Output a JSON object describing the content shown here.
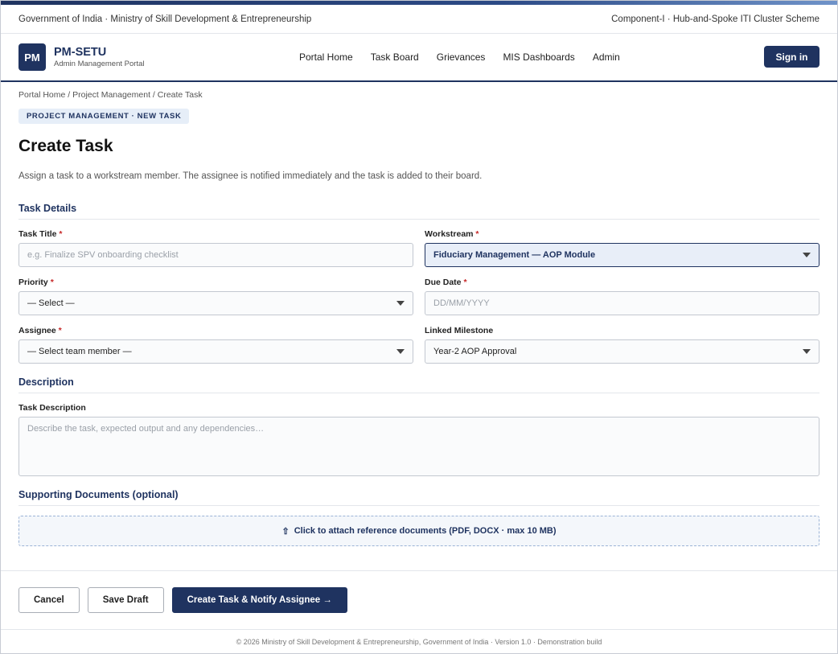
{
  "gov_bar": {
    "left": "Government of India · Ministry of Skill Development & Entrepreneurship",
    "right": "Component-I · Hub-and-Spoke ITI Cluster Scheme"
  },
  "header": {
    "logo": "PM",
    "title": "PM-SETU",
    "subtitle": "Admin Management Portal",
    "nav": [
      "Portal Home",
      "Task Board",
      "Grievances",
      "MIS Dashboards",
      "Admin"
    ],
    "signin_label": "Sign in"
  },
  "breadcrumb": "Portal Home / Project Management / Create Task",
  "tag": "PROJECT MANAGEMENT · NEW TASK",
  "page_title": "Create Task",
  "intro": "Assign a task to a workstream member. The assignee is notified immediately and the task is added to their board.",
  "sections": {
    "details": "Task Details",
    "description": "Description",
    "documents": "Supporting Documents (optional)"
  },
  "form": {
    "task_title": {
      "label": "Task Title",
      "placeholder": "e.g. Finalize SPV onboarding checklist"
    },
    "workstream": {
      "label": "Workstream",
      "value": "Fiduciary Management — AOP Module"
    },
    "priority": {
      "label": "Priority",
      "value": "— Select —"
    },
    "due_date": {
      "label": "Due Date",
      "placeholder": "DD/MM/YYYY"
    },
    "assignee": {
      "label": "Assignee",
      "value": "— Select team member —"
    },
    "milestone": {
      "label": "Linked Milestone",
      "value": "Year-2 AOP Approval"
    },
    "description": {
      "label": "Task Description",
      "placeholder": "Describe the task, expected output and any dependencies…"
    },
    "upload": {
      "icon": "⇧",
      "label": "Click to attach reference documents (PDF, DOCX · max 10 MB)"
    },
    "required_marker": "*"
  },
  "actions": {
    "cancel": "Cancel",
    "save_draft": "Save Draft",
    "create": "Create Task & Notify Assignee →"
  },
  "footer": "© 2026 Ministry of Skill Development & Entrepreneurship, Government of India · Version 1.0 · Demonstration build",
  "colors": {
    "primary": "#1f3360",
    "required": "#c62828",
    "tag_bg": "#e6eef8"
  },
  "icons": {
    "caret": "chevron-down-icon",
    "upload": "upload-icon"
  }
}
